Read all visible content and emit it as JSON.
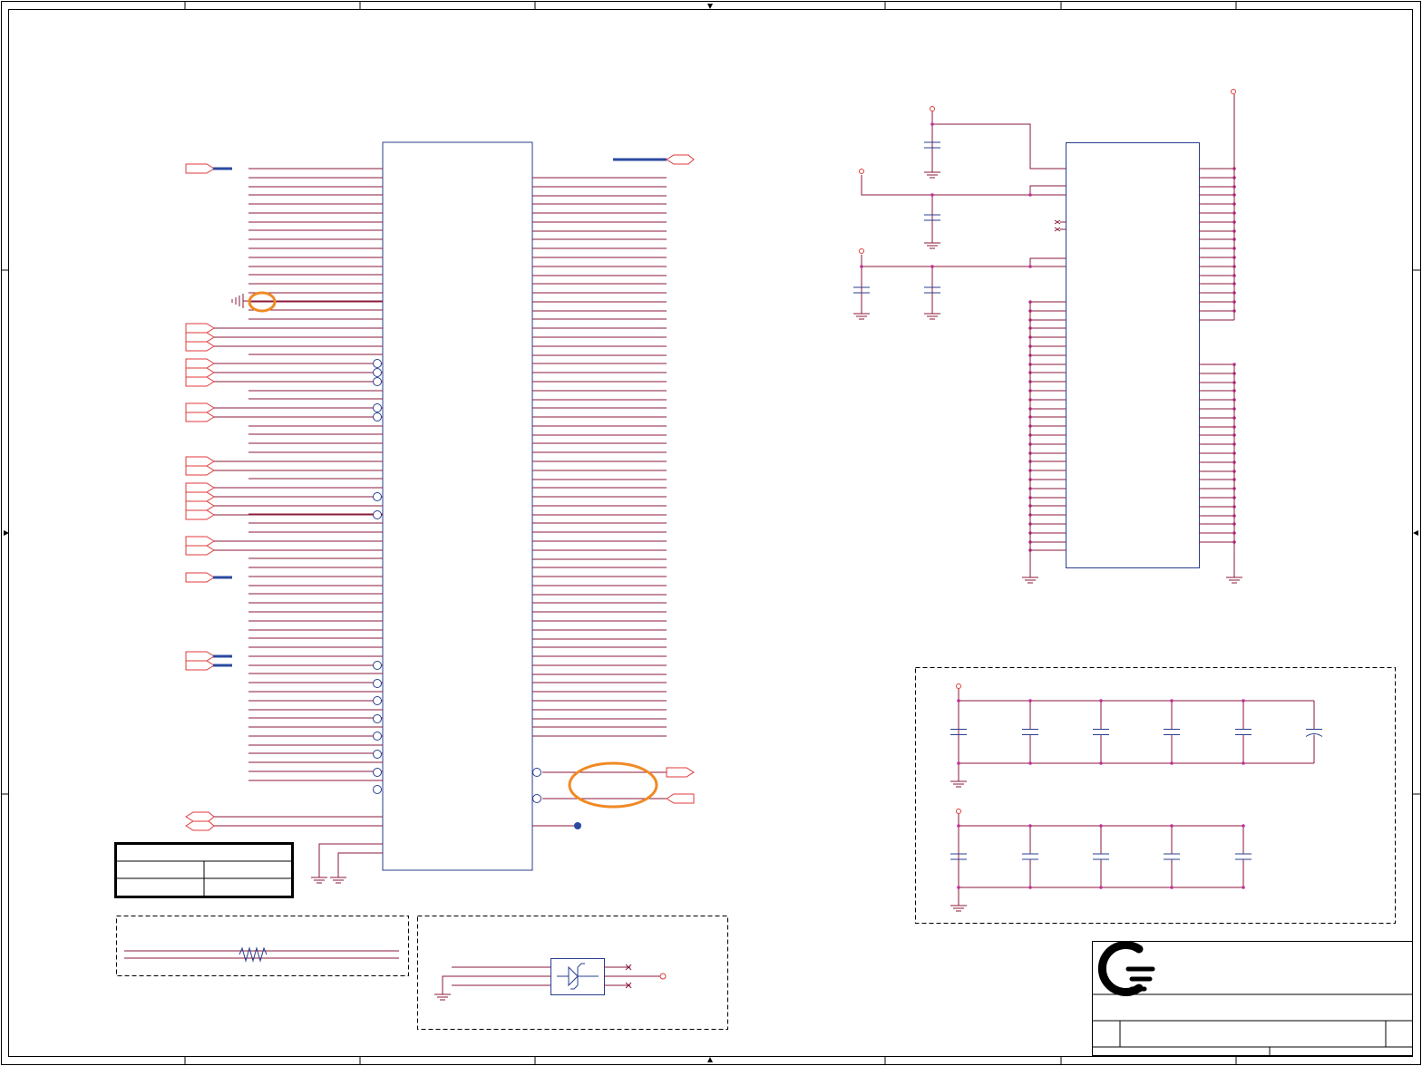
{
  "colors": {
    "wire": "#8b1a3a",
    "body": "#2a3f8f",
    "port": "#e03a3a",
    "highlight": "#f08a24",
    "pin_dot": "#c0309a",
    "black": "#000000",
    "bus": "#2b4aa0"
  },
  "icons": {
    "logo": "company-logo",
    "ground": "ground-symbol",
    "capacitor": "capacitor-symbol",
    "resistor": "resistor-symbol",
    "power_port": "power-port-symbol",
    "diode": "diode-symbol"
  },
  "title_block": {
    "title_value": "",
    "sheet_value": ""
  },
  "revision_table": {
    "rows": [
      [
        "",
        ""
      ],
      [
        "",
        ""
      ]
    ]
  },
  "highlights": [
    {
      "name": "ground-pin-highlight"
    },
    {
      "name": "output-pair-highlight"
    }
  ]
}
